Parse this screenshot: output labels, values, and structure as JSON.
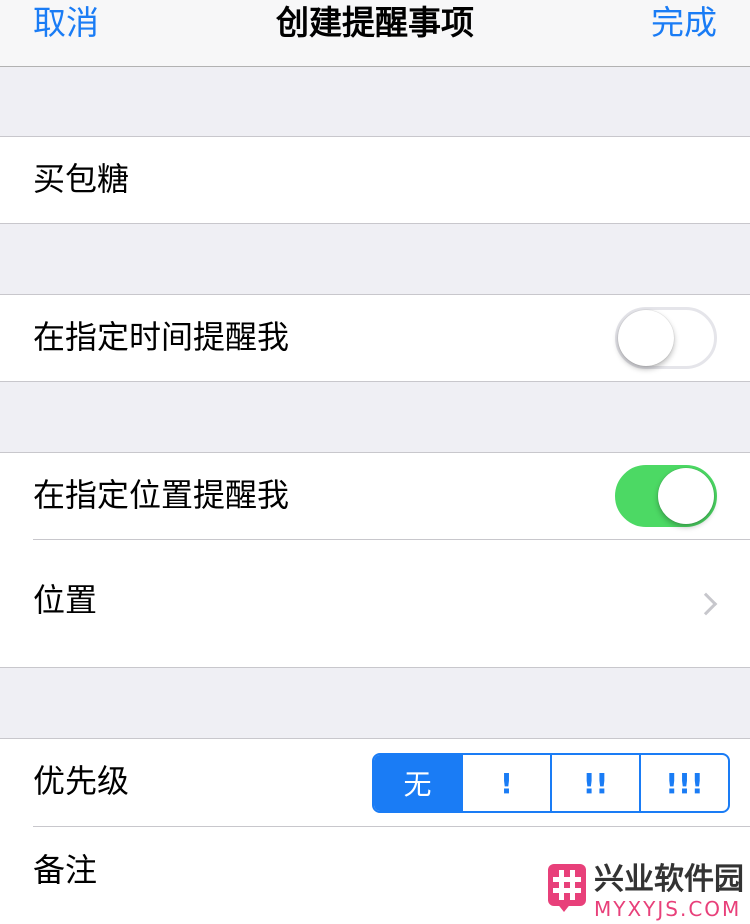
{
  "navbar": {
    "cancel_label": "取消",
    "title": "创建提醒事项",
    "done_label": "完成"
  },
  "reminder": {
    "title_value": "买包糖"
  },
  "time_alert": {
    "label": "在指定时间提醒我",
    "enabled": false
  },
  "location_alert": {
    "label": "在指定位置提醒我",
    "enabled": true,
    "location_label": "位置"
  },
  "priority": {
    "label": "优先级",
    "options": [
      "无",
      "!",
      "!!",
      "!!!"
    ],
    "selected": "无"
  },
  "notes": {
    "label": "备注"
  },
  "watermark": {
    "name": "兴业软件园",
    "url": "MYXYJS.COM"
  },
  "colors": {
    "accent": "#1a7cf5",
    "switch_on": "#4cd964",
    "background": "#efeff4"
  }
}
